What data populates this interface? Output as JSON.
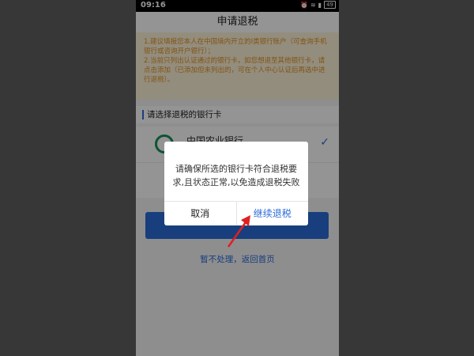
{
  "status_bar": {
    "time": "09:16",
    "battery": "49"
  },
  "header": {
    "title": "申请退税"
  },
  "notice": {
    "lines": [
      "1.建议填报您本人在中国境内开立的Ⅰ类银行账户（可查询手机银行或咨询开户银行）；",
      "2.当前只列出认证通过的银行卡，如您想退至其他银行卡，请点击添加（已添加但未列出的，可在个人中心认证后再选中进行退税）。"
    ]
  },
  "section": {
    "title": "请选择退税的银行卡"
  },
  "banks": [
    {
      "name": "中国农业银行",
      "selected": true
    }
  ],
  "actions": {
    "primary_label": "",
    "home_link": "暂不处理，返回首页"
  },
  "dialog": {
    "message": "请确保所选的银行卡符合退税要求,且状态正常,以免造成退税失败",
    "cancel_label": "取消",
    "continue_label": "继续退税"
  },
  "colors": {
    "accent": "#2a6bd9",
    "notice_text": "#e0901e",
    "notice_bg": "#fdf3d9",
    "arrow": "#e02020"
  }
}
